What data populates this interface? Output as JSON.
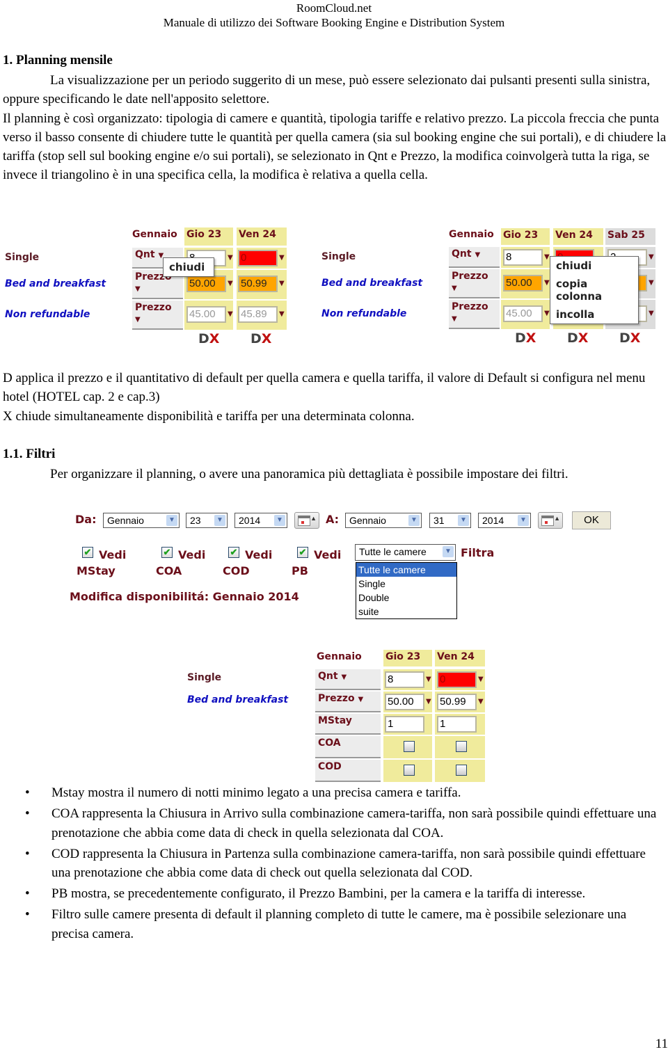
{
  "header": {
    "site": "RoomCloud.net",
    "subtitle": "Manuale di utilizzo dei Software Booking Engine e Distribution System"
  },
  "section1": {
    "title": "1. Planning mensile",
    "para_indent": "La visualizzazione per un periodo suggerito di un mese, può essere selezionato dai pulsanti presenti sulla sinistra, oppure specificando le date nell'apposito selettore.",
    "para_2": "Il planning è così organizzato: tipologia di camere e quantità, tipologia tariffe e relativo prezzo. La piccola freccia che punta verso il basso consente di chiudere tutte le quantità per quella camera (sia sul booking engine che sui portali), e di chiudere la tariffa (stop sell sul booking engine e/o sui portali), se selezionato in Qnt e Prezzo, la modifica coinvolgerà tutta la riga, se invece il triangolino è in una specifica cella, la modifica è relativa a quella cella."
  },
  "planning_left": {
    "month": "Gennaio",
    "days": [
      "Gio 23",
      "Ven 24"
    ],
    "room": "Single",
    "rates": [
      "Bed and breakfast",
      "Non refundable"
    ],
    "qnt_label": "Qnt",
    "prezzo_label": "Prezzo",
    "qnt_values": [
      "8",
      "0"
    ],
    "bb_prices": [
      "50.00",
      "50.99"
    ],
    "nr_prices": [
      "45.00",
      "45.89"
    ],
    "popup_items": [
      "chiudi"
    ],
    "d_label": "D",
    "x_label": "X"
  },
  "planning_right": {
    "month": "Gennaio",
    "days": [
      "Gio 23",
      "Ven 24",
      "Sab 25"
    ],
    "room": "Single",
    "rates": [
      "Bed and breakfast",
      "Non refundable"
    ],
    "qnt_label": "Qnt",
    "prezzo_label": "Prezzo",
    "qnt_values": [
      "8",
      "0",
      "2"
    ],
    "bb_prices": [
      "50.00",
      "",
      ""
    ],
    "nr_prices": [
      "45.00",
      "",
      ""
    ],
    "popup_items": [
      "chiudi",
      "copia colonna",
      "incolla"
    ],
    "d_label": "D",
    "x_label": "X"
  },
  "explanations": {
    "d_text": "D applica il prezzo e il quantitativo di default per quella camera e quella tariffa, il valore di Default si configura nel menu hotel (HOTEL cap. 2 e cap.3)",
    "x_text": "X chiude simultaneamente disponibilità e tariffa per una determinata colonna."
  },
  "section11": {
    "title": "1.1. Filtri",
    "para_indent": "Per organizzare il planning, o avere una panoramica più dettagliata è possibile impostare dei filtri."
  },
  "filters": {
    "from_label": "Da:",
    "from_month": "Gennaio",
    "from_day": "23",
    "from_year": "2014",
    "to_label": "A:",
    "to_month": "Gennaio",
    "to_day": "31",
    "to_year": "2014",
    "ok_label": "OK",
    "checkboxes": [
      {
        "line1": "Vedi",
        "line2": "MStay",
        "checked": true
      },
      {
        "line1": "Vedi",
        "line2": "COA",
        "checked": true
      },
      {
        "line1": "Vedi",
        "line2": "COD",
        "checked": true
      },
      {
        "line1": "Vedi",
        "line2": "PB",
        "checked": true
      }
    ],
    "room_filter_selected": "Tutte le camere",
    "room_filter_options": [
      "Tutte le camere",
      "Single",
      "Double",
      "suite"
    ],
    "filter_button": "Filtra",
    "availability_title": "Modifica disponibilitá: Gennaio 2014"
  },
  "planning_bottom": {
    "month": "Gennaio",
    "days": [
      "Gio 23",
      "Ven 24"
    ],
    "room": "Single",
    "rate": "Bed and breakfast",
    "qnt_label": "Qnt",
    "prezzo_label": "Prezzo",
    "mstay_label": "MStay",
    "coa_label": "COA",
    "cod_label": "COD",
    "qnt_values": [
      "8",
      "0"
    ],
    "prices": [
      "50.00",
      "50.99"
    ],
    "mstay_values": [
      "1",
      "1"
    ],
    "coa_checked": [
      false,
      false
    ],
    "cod_checked": [
      false,
      false
    ]
  },
  "bullets": [
    "Mstay mostra il numero di notti minimo legato a una precisa camera e tariffa.",
    "COA rappresenta la Chiusura in Arrivo sulla combinazione camera-tariffa, non sarà possibile quindi effettuare una prenotazione che abbia come data di check in quella selezionata dal COA.",
    "COD rappresenta la Chiusura in Partenza sulla combinazione camera-tariffa, non sarà possibile quindi effettuare una prenotazione che abbia come data di check out quella selezionata dal COD.",
    "PB mostra, se precedentemente configurato, il Prezzo Bambini, per la camera e la tariffa di interesse.",
    "Filtro sulle camere presenta di default il planning completo di tutte le camere, ma è possibile selezionare una precisa camera."
  ],
  "page_number": "11"
}
